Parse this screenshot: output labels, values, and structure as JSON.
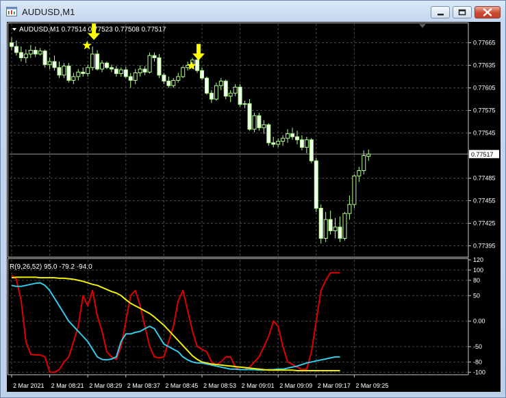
{
  "window": {
    "title": "AUDUSD,M1",
    "icon": "chart-window-icon",
    "controls": [
      "minimize-icon",
      "maximize-icon",
      "close-icon"
    ]
  },
  "colors": {
    "background": "#000000",
    "grid": "#4a4a4a",
    "axis": "#c8c8c8",
    "text": "#ffffff",
    "candle": "#b4ff8c",
    "candle_fill": "#f2fff0",
    "arrow": "#ffff00",
    "rsi_fast": "#e00000",
    "rsi_mid": "#33ccee",
    "rsi_slow": "#f0f000"
  },
  "chart_data": [
    {
      "type": "candlestick",
      "symbol": "AUDUSD",
      "timeframe": "M1",
      "header": "AUDUSD,M1  0.77514 0.77523 0.77508 0.77517",
      "ohlc_current": {
        "open": 0.77514,
        "high": 0.77523,
        "low": 0.77508,
        "close": 0.77517
      },
      "current_price": "0.77517",
      "ylim": [
        0.7738,
        0.7769
      ],
      "y_ticks": [
        "0.77665",
        "0.77635",
        "0.77605",
        "0.77575",
        "0.77545",
        "0.77485",
        "0.77455",
        "0.77425",
        "0.77395"
      ],
      "x_ticks": [
        "2 Mar 2021",
        "2 Mar 08:21",
        "2 Mar 08:29",
        "2 Mar 08:37",
        "2 Mar 08:45",
        "2 Mar 08:53",
        "2 Mar 09:01",
        "2 Mar 09:09",
        "2 Mar 09:17",
        "2 Mar 09:25"
      ],
      "grid": true,
      "signals": [
        {
          "bar": 17,
          "price": 0.77665,
          "type": "sell-arrow"
        },
        {
          "bar": 39,
          "price": 0.77638,
          "type": "sell-arrow"
        }
      ],
      "candles": [
        {
          "o": 0.77665,
          "h": 0.77672,
          "l": 0.77655,
          "c": 0.7766
        },
        {
          "o": 0.7766,
          "h": 0.77668,
          "l": 0.77648,
          "c": 0.77652
        },
        {
          "o": 0.77652,
          "h": 0.7766,
          "l": 0.7764,
          "c": 0.77645
        },
        {
          "o": 0.77645,
          "h": 0.77656,
          "l": 0.77638,
          "c": 0.7765
        },
        {
          "o": 0.7765,
          "h": 0.77662,
          "l": 0.77645,
          "c": 0.77655
        },
        {
          "o": 0.77655,
          "h": 0.7766,
          "l": 0.77646,
          "c": 0.7765
        },
        {
          "o": 0.7765,
          "h": 0.77658,
          "l": 0.77648,
          "c": 0.77654
        },
        {
          "o": 0.77654,
          "h": 0.77656,
          "l": 0.77632,
          "c": 0.77636
        },
        {
          "o": 0.77636,
          "h": 0.77645,
          "l": 0.7763,
          "c": 0.7764
        },
        {
          "o": 0.7764,
          "h": 0.77648,
          "l": 0.77628,
          "c": 0.77632
        },
        {
          "o": 0.77632,
          "h": 0.7764,
          "l": 0.77618,
          "c": 0.77622
        },
        {
          "o": 0.77622,
          "h": 0.77638,
          "l": 0.77618,
          "c": 0.77634
        },
        {
          "o": 0.77634,
          "h": 0.77638,
          "l": 0.77612,
          "c": 0.77615
        },
        {
          "o": 0.77615,
          "h": 0.77625,
          "l": 0.7761,
          "c": 0.7762
        },
        {
          "o": 0.7762,
          "h": 0.7763,
          "l": 0.77615,
          "c": 0.77626
        },
        {
          "o": 0.77626,
          "h": 0.77632,
          "l": 0.7762,
          "c": 0.77624
        },
        {
          "o": 0.77624,
          "h": 0.77636,
          "l": 0.7762,
          "c": 0.77632
        },
        {
          "o": 0.77632,
          "h": 0.7766,
          "l": 0.77628,
          "c": 0.7765
        },
        {
          "o": 0.7765,
          "h": 0.77655,
          "l": 0.77628,
          "c": 0.7763
        },
        {
          "o": 0.7763,
          "h": 0.77642,
          "l": 0.77626,
          "c": 0.77638
        },
        {
          "o": 0.77638,
          "h": 0.7764,
          "l": 0.7763,
          "c": 0.77632
        },
        {
          "o": 0.77632,
          "h": 0.77636,
          "l": 0.77626,
          "c": 0.7763
        },
        {
          "o": 0.7763,
          "h": 0.77634,
          "l": 0.7762,
          "c": 0.77624
        },
        {
          "o": 0.77624,
          "h": 0.77632,
          "l": 0.7762,
          "c": 0.77629
        },
        {
          "o": 0.77629,
          "h": 0.77633,
          "l": 0.77618,
          "c": 0.7762
        },
        {
          "o": 0.7762,
          "h": 0.77625,
          "l": 0.77605,
          "c": 0.77615
        },
        {
          "o": 0.77615,
          "h": 0.7763,
          "l": 0.7761,
          "c": 0.77625
        },
        {
          "o": 0.77625,
          "h": 0.77635,
          "l": 0.7762,
          "c": 0.7763
        },
        {
          "o": 0.7763,
          "h": 0.77634,
          "l": 0.77622,
          "c": 0.77626
        },
        {
          "o": 0.77626,
          "h": 0.77652,
          "l": 0.77624,
          "c": 0.77648
        },
        {
          "o": 0.77648,
          "h": 0.77652,
          "l": 0.7764,
          "c": 0.77645
        },
        {
          "o": 0.77645,
          "h": 0.7765,
          "l": 0.77618,
          "c": 0.77622
        },
        {
          "o": 0.77622,
          "h": 0.77625,
          "l": 0.7761,
          "c": 0.77614
        },
        {
          "o": 0.77614,
          "h": 0.7762,
          "l": 0.77605,
          "c": 0.77608
        },
        {
          "o": 0.77608,
          "h": 0.77618,
          "l": 0.77605,
          "c": 0.77615
        },
        {
          "o": 0.77615,
          "h": 0.77625,
          "l": 0.77612,
          "c": 0.7762
        },
        {
          "o": 0.7762,
          "h": 0.77634,
          "l": 0.77618,
          "c": 0.77632
        },
        {
          "o": 0.77632,
          "h": 0.7764,
          "l": 0.77628,
          "c": 0.77635
        },
        {
          "o": 0.77635,
          "h": 0.77645,
          "l": 0.7763,
          "c": 0.77642
        },
        {
          "o": 0.77642,
          "h": 0.77646,
          "l": 0.77625,
          "c": 0.77628
        },
        {
          "o": 0.77628,
          "h": 0.77632,
          "l": 0.77615,
          "c": 0.77618
        },
        {
          "o": 0.77618,
          "h": 0.7762,
          "l": 0.77596,
          "c": 0.77598
        },
        {
          "o": 0.77598,
          "h": 0.77602,
          "l": 0.77585,
          "c": 0.7759
        },
        {
          "o": 0.7759,
          "h": 0.77612,
          "l": 0.77588,
          "c": 0.77608
        },
        {
          "o": 0.77608,
          "h": 0.77618,
          "l": 0.77602,
          "c": 0.77614
        },
        {
          "o": 0.77614,
          "h": 0.77616,
          "l": 0.7759,
          "c": 0.77594
        },
        {
          "o": 0.77594,
          "h": 0.77602,
          "l": 0.77586,
          "c": 0.77598
        },
        {
          "o": 0.77598,
          "h": 0.7761,
          "l": 0.77594,
          "c": 0.77606
        },
        {
          "o": 0.77606,
          "h": 0.7761,
          "l": 0.7758,
          "c": 0.77583
        },
        {
          "o": 0.77583,
          "h": 0.77588,
          "l": 0.77578,
          "c": 0.77584
        },
        {
          "o": 0.77584,
          "h": 0.7759,
          "l": 0.77548,
          "c": 0.7755
        },
        {
          "o": 0.7755,
          "h": 0.77572,
          "l": 0.77546,
          "c": 0.77568
        },
        {
          "o": 0.77568,
          "h": 0.77572,
          "l": 0.77548,
          "c": 0.77552
        },
        {
          "o": 0.77552,
          "h": 0.77562,
          "l": 0.77544,
          "c": 0.77556
        },
        {
          "o": 0.77556,
          "h": 0.77558,
          "l": 0.77528,
          "c": 0.77532
        },
        {
          "o": 0.77532,
          "h": 0.7754,
          "l": 0.77526,
          "c": 0.7753
        },
        {
          "o": 0.7753,
          "h": 0.77538,
          "l": 0.77526,
          "c": 0.77534
        },
        {
          "o": 0.77534,
          "h": 0.77542,
          "l": 0.77528,
          "c": 0.77538
        },
        {
          "o": 0.77538,
          "h": 0.7755,
          "l": 0.77532,
          "c": 0.77544
        },
        {
          "o": 0.77544,
          "h": 0.77552,
          "l": 0.77536,
          "c": 0.7754
        },
        {
          "o": 0.7754,
          "h": 0.77548,
          "l": 0.7753,
          "c": 0.77536
        },
        {
          "o": 0.77536,
          "h": 0.77542,
          "l": 0.77522,
          "c": 0.77526
        },
        {
          "o": 0.77526,
          "h": 0.7754,
          "l": 0.77518,
          "c": 0.77536
        },
        {
          "o": 0.77536,
          "h": 0.77538,
          "l": 0.77505,
          "c": 0.77508
        },
        {
          "o": 0.77508,
          "h": 0.77512,
          "l": 0.7744,
          "c": 0.77445
        },
        {
          "o": 0.77445,
          "h": 0.7745,
          "l": 0.77398,
          "c": 0.77405
        },
        {
          "o": 0.77405,
          "h": 0.7744,
          "l": 0.774,
          "c": 0.7743
        },
        {
          "o": 0.7743,
          "h": 0.77442,
          "l": 0.7741,
          "c": 0.77415
        },
        {
          "o": 0.77415,
          "h": 0.77432,
          "l": 0.77405,
          "c": 0.7742
        },
        {
          "o": 0.7742,
          "h": 0.77434,
          "l": 0.774,
          "c": 0.77405
        },
        {
          "o": 0.77405,
          "h": 0.7744,
          "l": 0.77402,
          "c": 0.77438
        },
        {
          "o": 0.77438,
          "h": 0.77462,
          "l": 0.7743,
          "c": 0.7745
        },
        {
          "o": 0.7745,
          "h": 0.7749,
          "l": 0.77445,
          "c": 0.77488
        },
        {
          "o": 0.77488,
          "h": 0.775,
          "l": 0.7748,
          "c": 0.77495
        },
        {
          "o": 0.77495,
          "h": 0.77522,
          "l": 0.7749,
          "c": 0.77515
        },
        {
          "o": 0.77514,
          "h": 0.77523,
          "l": 0.77508,
          "c": 0.77517
        }
      ]
    },
    {
      "type": "line",
      "label": "R(9,26,52) 95.0 -79.2 -94.0",
      "ylim": [
        -105,
        120
      ],
      "y_ticks": [
        "120",
        "100",
        "80",
        "50",
        "0.00",
        "-50",
        "-80",
        "-100"
      ],
      "grid": true,
      "series": [
        {
          "name": "9",
          "color": "#e00000",
          "values": [
            90,
            82,
            40,
            -40,
            -65,
            -66,
            -66,
            -70,
            -100,
            -100,
            -95,
            -80,
            -70,
            -40,
            -10,
            50,
            30,
            60,
            10,
            -20,
            -60,
            -70,
            -75,
            -50,
            0,
            50,
            60,
            30,
            -10,
            -50,
            -70,
            -72,
            -70,
            -40,
            -10,
            40,
            60,
            20,
            -20,
            -50,
            -55,
            -60,
            -80,
            -85,
            -80,
            -70,
            -70,
            -90,
            -95,
            -95,
            -90,
            -80,
            -70,
            -50,
            -30,
            0,
            -10,
            -50,
            -80,
            -85,
            -90,
            -95,
            -94,
            -60,
            0,
            60,
            80,
            95,
            95,
            95
          ]
        },
        {
          "name": "26",
          "color": "#33ccee",
          "values": [
            70,
            68,
            68,
            70,
            72,
            74,
            75,
            70,
            60,
            45,
            30,
            15,
            0,
            -10,
            -20,
            -30,
            -40,
            -55,
            -70,
            -75,
            -76,
            -74,
            -70,
            -40,
            -25,
            -25,
            -22,
            -20,
            -15,
            -10,
            -15,
            -30,
            -45,
            -50,
            -55,
            -60,
            -70,
            -76,
            -80,
            -82,
            -82,
            -84,
            -86,
            -88,
            -90,
            -92,
            -94,
            -94,
            -95,
            -95,
            -95,
            -95,
            -96,
            -96,
            -95,
            -95,
            -94,
            -94,
            -92,
            -90,
            -88,
            -85,
            -82,
            -80,
            -78,
            -76,
            -74,
            -72,
            -70,
            -70
          ]
        },
        {
          "name": "52",
          "color": "#f0f000",
          "values": [
            85,
            86,
            86,
            86,
            86,
            86,
            85,
            85,
            85,
            85,
            84,
            84,
            83,
            82,
            80,
            78,
            75,
            72,
            70,
            66,
            62,
            58,
            55,
            50,
            42,
            35,
            30,
            25,
            20,
            15,
            8,
            0,
            -8,
            -18,
            -28,
            -38,
            -48,
            -58,
            -68,
            -75,
            -80,
            -82,
            -84,
            -85,
            -86,
            -87,
            -88,
            -89,
            -90,
            -91,
            -92,
            -93,
            -94,
            -95,
            -96,
            -96,
            -96,
            -96,
            -96,
            -96,
            -97,
            -97,
            -97,
            -97,
            -97,
            -97,
            -97,
            -97,
            -97,
            -97
          ]
        }
      ]
    }
  ]
}
